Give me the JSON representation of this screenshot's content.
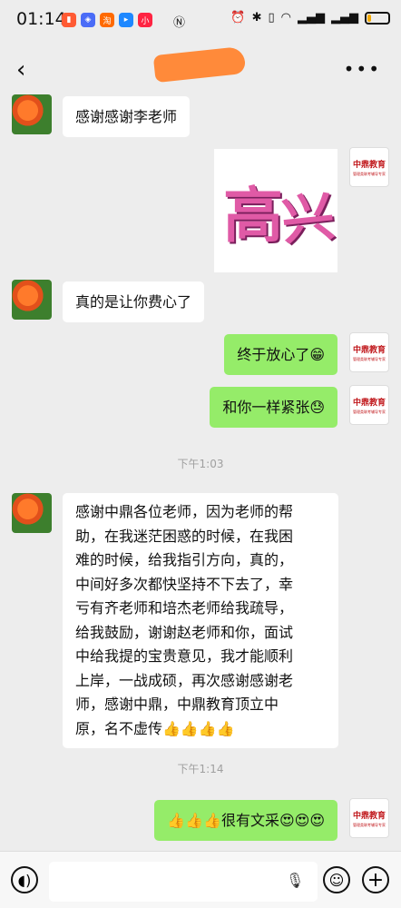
{
  "status": {
    "time": "01:14",
    "app_icons": [
      {
        "icon": "video-app-icon",
        "color": "#ff5a33",
        "glyph": "▮"
      },
      {
        "icon": "game-app-icon",
        "color": "#4a6cf7",
        "glyph": "◈"
      },
      {
        "icon": "taobao-icon",
        "color": "#ff6a00",
        "glyph": "淘"
      },
      {
        "icon": "app-store-icon",
        "color": "#1e88ff",
        "glyph": "▸"
      },
      {
        "icon": "xiaohongshu-icon",
        "color": "#ff2442",
        "glyph": "小"
      }
    ],
    "system_icons": [
      "nfc-icon",
      "alarm-icon",
      "bluetooth-icon",
      "vibrate-icon",
      "wifi-icon",
      "signal-icon",
      "signal-icon"
    ],
    "battery_level": 0.15
  },
  "header": {
    "back_glyph": "‹",
    "more_glyph": "•••"
  },
  "messages": {
    "m1": "感谢感谢李老师",
    "sticker_chars": [
      "高",
      "兴"
    ],
    "m3": "真的是让你费心了",
    "m4": "终于放心了😁",
    "m5": "和你一样紧张😓",
    "time1": "下午1:03",
    "m6_lines": [
      "感谢中鼎各位老师，因为老师的帮",
      "助，在我迷茫困惑的时候，在我困",
      "难的时候，给我指引方向，真的，",
      "中间好多次都快坚持不下去了，幸",
      "亏有齐老师和培杰老师给我疏导，",
      "给我鼓励，谢谢赵老师和你，面试",
      "中给我提的宝贵意见，我才能顺利",
      "上岸，一战成硕，再次感谢感谢老",
      "师，感谢中鼎，中鼎教育顶立中",
      "原，名不虚传👍👍👍👍"
    ],
    "time2": "下午1:14",
    "m7": "👍👍👍很有文采😍😍😍"
  },
  "logo": {
    "name": "中鼎教育",
    "sub": "管理类联考辅导专家"
  },
  "input": {
    "value": ""
  },
  "colors": {
    "outgoing": "#95ec69",
    "incoming": "#ffffff",
    "background": "#ededed",
    "brand_red": "#c0161a"
  }
}
